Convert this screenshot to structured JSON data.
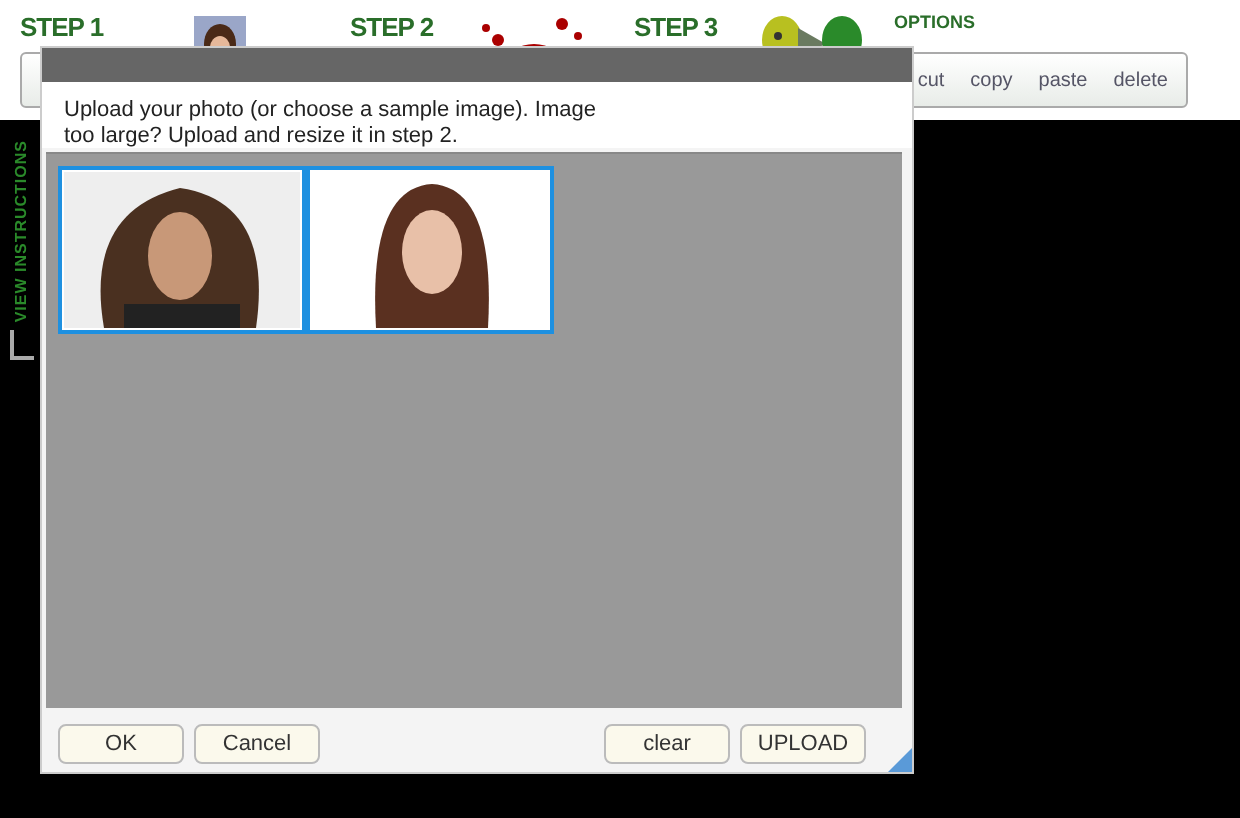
{
  "header": {
    "steps": [
      {
        "label": "STEP 1",
        "kind": "photo"
      },
      {
        "label": "STEP 2",
        "kind": "splat"
      },
      {
        "label": "STEP 3",
        "kind": "faces"
      }
    ],
    "options": "OPTIONS"
  },
  "toolbar": {
    "buttons": [
      "cut",
      "copy",
      "paste",
      "delete"
    ]
  },
  "sidebar": {
    "label": "VIEW INSTRUCTIONS"
  },
  "dialog": {
    "message": "Upload your photo (or choose a sample image). Image too large? Upload and resize it in step 2.",
    "samples": [
      {
        "kind": "man"
      },
      {
        "kind": "woman"
      }
    ],
    "left_buttons": [
      "OK",
      "Cancel"
    ],
    "right_buttons": [
      "clear",
      "UPLOAD"
    ]
  }
}
